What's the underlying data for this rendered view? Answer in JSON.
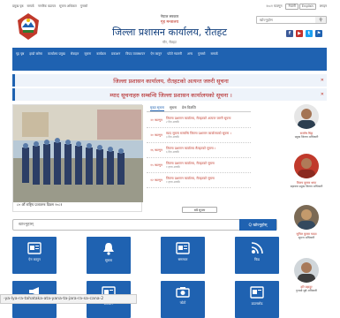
{
  "topbar": {
    "links": [
      "प्रमुख पृष्ठ",
      "सम्पर्क",
      "नागरिक बडापत्र",
      "सूचना अधिकार",
      "गुनासो"
    ],
    "date": "२०८१ फाल्गुन",
    "lang": [
      "नेपाली",
      "English"
    ],
    "login": "लगइन"
  },
  "header": {
    "line1": "नेपाल सरकार",
    "line2": "गृह मन्त्रालय",
    "title": "जिल्ला प्रशासन कार्यालय, रौतहट",
    "line4": "गौर, रौतहट",
    "search_placeholder": "खोज्नुहोस",
    "search_icon": "search-icon"
  },
  "nav": {
    "items": [
      "गृह पृष्ठ",
      "हाम्रो बारेमा",
      "कार्यालय प्रमुख",
      "सेवाहरु",
      "सूचना",
      "कार्यक्रम",
      "प्रकाशन",
      "विपद व्यवस्थापन",
      "ऐन कानुन",
      "फोटो ग्यालरी",
      "अन्य",
      "गुनासो",
      "सम्पर्क"
    ]
  },
  "notices": {
    "n1": "जिल्ला प्रशासन कार्यालय, रौतहटको अत्यन्त जरुरी सूचना",
    "n2": "म्याद सूचनाहरु सम्बन्धि जिल्ला प्रशासन कार्यालयको सूचना ।"
  },
  "photo": {
    "caption": "८० औं राष्ट्रिय प्रजातन्त्र दिवस २०८१"
  },
  "tabs": [
    "मुख्य सूचना",
    "सूचना",
    "प्रेस विज्ञप्ति"
  ],
  "news": [
    {
      "date": "२१ फाल्गुन",
      "title": "जिल्ला प्रशासन कार्यालय, रौतहटको अत्यन्त जरुरी सूचना",
      "meta": "२ दिन अगाडि"
    },
    {
      "date": "२० फाल्गुन",
      "title": "म्याद सूचना सम्बन्धि जिल्ला प्रशासन कार्यालयको सूचना ।",
      "meta": "३ दिन अगाडि"
    },
    {
      "date": "१६ फाल्गुन",
      "title": "जिल्ला प्रशासन कार्यालय रौतहटको सूचना ।",
      "meta": "६ दिन अगाडि"
    },
    {
      "date": "१५ फाल्गुन",
      "title": "जिल्ला प्रशासन कार्यालय, रौतहटको सूचना",
      "meta": "१ हप्ता अगाडि"
    },
    {
      "date": "१२ फाल्गुन",
      "title": "जिल्ला प्रशासन कार्यालय, रौतहटको सूचना",
      "meta": "१ हप्ता अगाडि"
    }
  ],
  "all_btn": "सबै सूचना",
  "officials": [
    {
      "name": "सन्तोष थिङ्ग",
      "role": "प्रमुख जिल्ला अधिकारी"
    },
    {
      "name": "विजय कुमार थापा",
      "role": "सहायक प्रमुख जिल्ला अधिकारी"
    },
    {
      "name": "सुनिल कुमार यादव",
      "role": "सूचना अधिकारी"
    },
    {
      "name": "हरि बहादुर",
      "role": "गुनासो सुन्ने अधिकारी"
    }
  ],
  "search2": {
    "placeholder": "खोज्नुहोस्",
    "button": "Q खोज्नुहोस्"
  },
  "tiles": [
    "ऐन कानुन",
    "सूचना",
    "समाचार",
    "फिड",
    "प्रेस",
    "प्रकाशन",
    "फोटो",
    "डाउनलोड"
  ],
  "status_url": "-ya-lya-ra-tahataka-ata-yana-ta-jara-ra-sa-cana-2",
  "colors": {
    "primary": "#1f62b1",
    "accent": "#c0392b"
  }
}
